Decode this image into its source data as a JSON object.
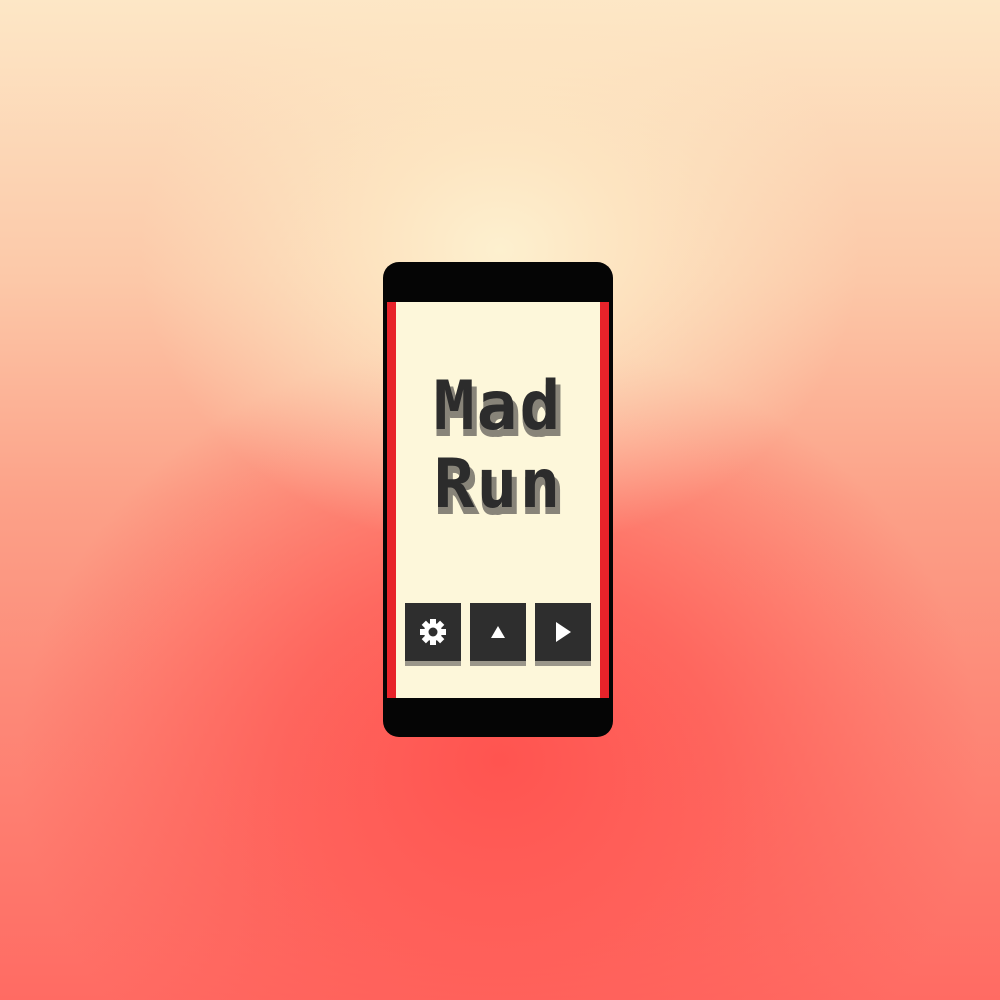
{
  "game": {
    "title_line1": "Mad",
    "title_line2": "Run",
    "colors": {
      "screen_background": "#fdf7da",
      "screen_border": "#e8232a",
      "phone_body": "#050505",
      "text": "#2c2c2c",
      "text_shadow": "#888479",
      "button": "#2e2e2e"
    }
  },
  "buttons": [
    {
      "action": "settings",
      "icon": "gear-icon"
    },
    {
      "action": "leaderboard",
      "icon": "triangle-up-icon"
    },
    {
      "action": "play",
      "icon": "play-icon"
    }
  ]
}
